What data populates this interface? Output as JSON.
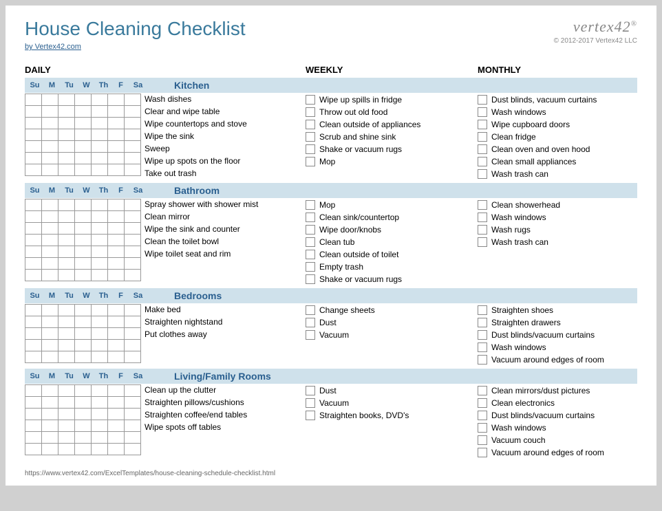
{
  "title": "House Cleaning Checklist",
  "byline": "by Vertex42.com",
  "brand": "vertex42",
  "copyright": "© 2012-2017 Vertex42 LLC",
  "columns": {
    "daily": "DAILY",
    "weekly": "WEEKLY",
    "monthly": "MONTHLY"
  },
  "days": [
    "Su",
    "M",
    "Tu",
    "W",
    "Th",
    "F",
    "Sa"
  ],
  "sections": [
    {
      "name": "Kitchen",
      "daily": [
        "Wash dishes",
        "Clear and wipe table",
        "Wipe countertops and stove",
        "Wipe the sink",
        "Sweep",
        "Wipe up spots on the floor",
        "Take out trash"
      ],
      "weekly": [
        "Wipe up spills in fridge",
        "Throw out old food",
        "Clean outside of appliances",
        "Scrub and shine sink",
        "Shake or vacuum rugs",
        "Mop"
      ],
      "monthly": [
        "Dust blinds, vacuum curtains",
        "Wash windows",
        "Wipe cupboard doors",
        "Clean fridge",
        "Clean oven and oven hood",
        "Clean small appliances",
        "Wash trash can"
      ]
    },
    {
      "name": "Bathroom",
      "daily": [
        "Spray shower with shower mist",
        "Clean mirror",
        "Wipe the sink and counter",
        "Clean the toilet bowl",
        "Wipe toilet seat and rim"
      ],
      "weekly": [
        "Mop",
        "Clean sink/countertop",
        "Wipe door/knobs",
        "Clean tub",
        "Clean outside of toilet",
        "Empty trash",
        "Shake or vacuum rugs"
      ],
      "monthly": [
        "Clean showerhead",
        "Wash windows",
        "Wash rugs",
        "Wash trash can"
      ]
    },
    {
      "name": "Bedrooms",
      "daily": [
        "Make bed",
        "Straighten nightstand",
        "Put clothes away"
      ],
      "weekly": [
        "Change sheets",
        "Dust",
        "Vacuum"
      ],
      "monthly": [
        "Straighten shoes",
        "Straighten drawers",
        "Dust blinds/vacuum curtains",
        "Wash windows",
        "Vacuum around edges of room"
      ]
    },
    {
      "name": "Living/Family Rooms",
      "daily": [
        "Clean up the clutter",
        "Straighten pillows/cushions",
        "Straighten coffee/end tables",
        "Wipe spots off tables"
      ],
      "weekly": [
        "Dust",
        "Vacuum",
        "Straighten books, DVD's"
      ],
      "monthly": [
        "Clean mirrors/dust pictures",
        "Clean electronics",
        "Dust blinds/vacuum curtains",
        "Wash windows",
        "Vacuum couch",
        "Vacuum around edges of room"
      ]
    }
  ],
  "footer": "https://www.vertex42.com/ExcelTemplates/house-cleaning-schedule-checklist.html"
}
